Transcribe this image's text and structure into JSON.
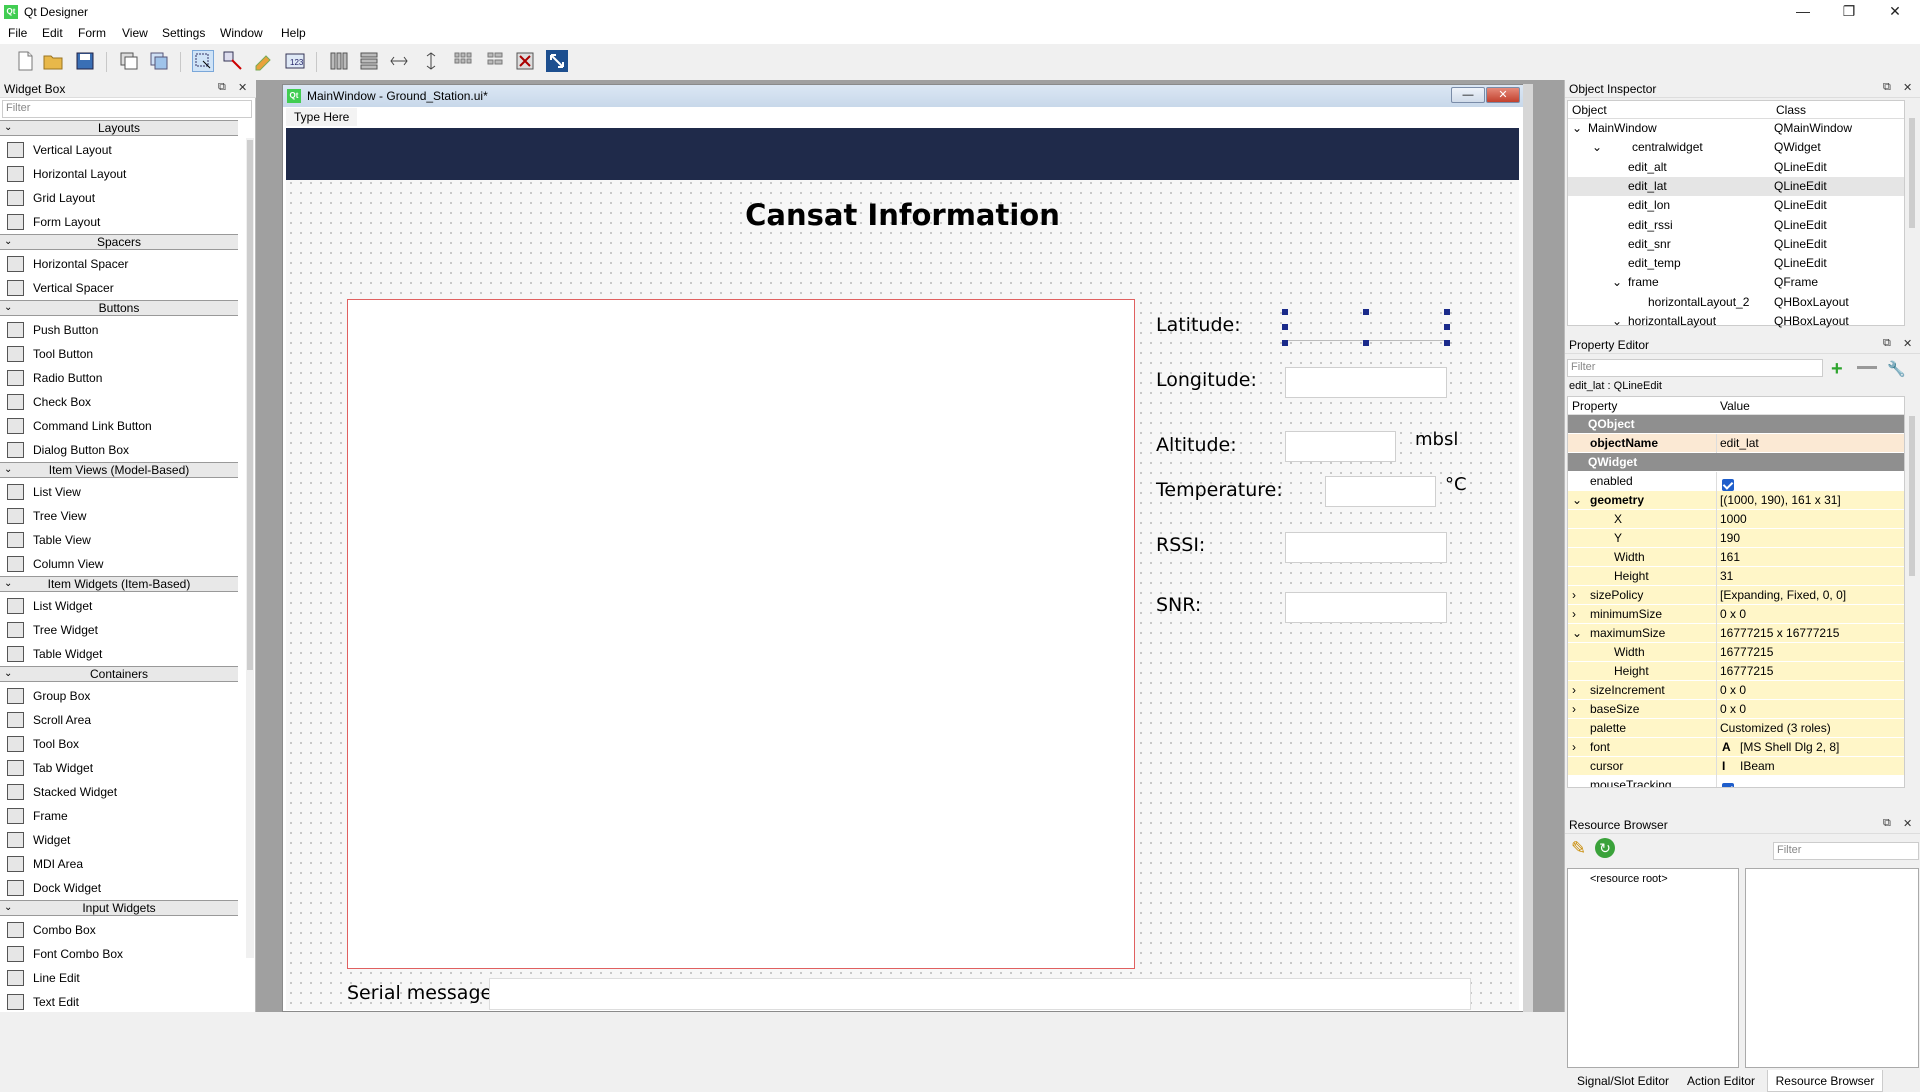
{
  "app": {
    "title": "Qt Designer",
    "logo": "Qt"
  },
  "window_buttons": {
    "minimize": "—",
    "maximize": "❐",
    "close": "✕"
  },
  "menu": [
    "File",
    "Edit",
    "Form",
    "View",
    "Settings",
    "Window",
    "Help"
  ],
  "widget_box": {
    "title": "Widget Box",
    "filter_placeholder": "Filter",
    "categories": [
      {
        "name": "Layouts",
        "items": [
          "Vertical Layout",
          "Horizontal Layout",
          "Grid Layout",
          "Form Layout"
        ]
      },
      {
        "name": "Spacers",
        "items": [
          "Horizontal Spacer",
          "Vertical Spacer"
        ]
      },
      {
        "name": "Buttons",
        "items": [
          "Push Button",
          "Tool Button",
          "Radio Button",
          "Check Box",
          "Command Link Button",
          "Dialog Button Box"
        ]
      },
      {
        "name": "Item Views (Model-Based)",
        "items": [
          "List View",
          "Tree View",
          "Table View",
          "Column View"
        ]
      },
      {
        "name": "Item Widgets (Item-Based)",
        "items": [
          "List Widget",
          "Tree Widget",
          "Table Widget"
        ]
      },
      {
        "name": "Containers",
        "items": [
          "Group Box",
          "Scroll Area",
          "Tool Box",
          "Tab Widget",
          "Stacked Widget",
          "Frame",
          "Widget",
          "MDI Area",
          "Dock Widget"
        ]
      },
      {
        "name": "Input Widgets",
        "items": [
          "Combo Box",
          "Font Combo Box",
          "Line Edit",
          "Text Edit"
        ]
      }
    ]
  },
  "form": {
    "window_title": "MainWindow - Ground_Station.ui*",
    "menu_placeholder": "Type Here",
    "heading": "Cansat Information",
    "fields": {
      "latitude": "Latitude:",
      "longitude": "Longitude:",
      "altitude": "Altitude:",
      "altitude_unit": "mbsl",
      "temperature": "Temperature:",
      "temperature_unit": "°C",
      "rssi": "RSSI:",
      "snr": "SNR:"
    },
    "serial_label": "Serial message:",
    "navbar_color": "#1f2a4a"
  },
  "object_inspector": {
    "title": "Object Inspector",
    "columns": [
      "Object",
      "Class"
    ],
    "rows": [
      {
        "object": "MainWindow",
        "class": "QMainWindow",
        "indent": 0,
        "expand": "⌄"
      },
      {
        "object": "centralwidget",
        "class": "QWidget",
        "indent": 1,
        "expand": "⌄"
      },
      {
        "object": "edit_alt",
        "class": "QLineEdit",
        "indent": 2,
        "expand": ""
      },
      {
        "object": "edit_lat",
        "class": "QLineEdit",
        "indent": 2,
        "expand": "",
        "selected": true
      },
      {
        "object": "edit_lon",
        "class": "QLineEdit",
        "indent": 2,
        "expand": ""
      },
      {
        "object": "edit_rssi",
        "class": "QLineEdit",
        "indent": 2,
        "expand": ""
      },
      {
        "object": "edit_snr",
        "class": "QLineEdit",
        "indent": 2,
        "expand": ""
      },
      {
        "object": "edit_temp",
        "class": "QLineEdit",
        "indent": 2,
        "expand": ""
      },
      {
        "object": "frame",
        "class": "QFrame",
        "indent": 2,
        "expand": "⌄"
      },
      {
        "object": "horizontalLayout_2",
        "class": "QHBoxLayout",
        "indent": 3,
        "expand": ""
      },
      {
        "object": "horizontalLayout",
        "class": "QHBoxLayout",
        "indent": 2,
        "expand": "⌄"
      }
    ]
  },
  "property_editor": {
    "title": "Property Editor",
    "filter_placeholder": "Filter",
    "context": "edit_lat : QLineEdit",
    "columns": [
      "Property",
      "Value"
    ],
    "rows": [
      {
        "name": "QObject",
        "value": "",
        "type": "group"
      },
      {
        "name": "objectName",
        "value": "edit_lat",
        "type": "beige",
        "bold": true
      },
      {
        "name": "QWidget",
        "value": "",
        "type": "group"
      },
      {
        "name": "enabled",
        "value": "",
        "type": "plain",
        "check": true
      },
      {
        "name": "geometry",
        "value": "[(1000, 190), 161 x 31]",
        "type": "yel",
        "bold": true,
        "expand": "⌄"
      },
      {
        "name": "X",
        "value": "1000",
        "type": "yel",
        "sub": true
      },
      {
        "name": "Y",
        "value": "190",
        "type": "yel",
        "sub": true
      },
      {
        "name": "Width",
        "value": "161",
        "type": "yel",
        "sub": true
      },
      {
        "name": "Height",
        "value": "31",
        "type": "yel",
        "sub": true
      },
      {
        "name": "sizePolicy",
        "value": "[Expanding, Fixed, 0, 0]",
        "type": "yel",
        "expand": "›"
      },
      {
        "name": "minimumSize",
        "value": "0 x 0",
        "type": "yel",
        "expand": "›"
      },
      {
        "name": "maximumSize",
        "value": "16777215 x 16777215",
        "type": "yel",
        "expand": "⌄"
      },
      {
        "name": "Width",
        "value": "16777215",
        "type": "yel",
        "sub": true
      },
      {
        "name": "Height",
        "value": "16777215",
        "type": "yel",
        "sub": true
      },
      {
        "name": "sizeIncrement",
        "value": "0 x 0",
        "type": "yel",
        "expand": "›"
      },
      {
        "name": "baseSize",
        "value": "0 x 0",
        "type": "yel",
        "expand": "›"
      },
      {
        "name": "palette",
        "value": "Customized (3 roles)",
        "type": "yel"
      },
      {
        "name": "font",
        "value": "[MS Shell Dlg 2, 8]",
        "type": "yel",
        "expand": "›",
        "prefix": "A"
      },
      {
        "name": "cursor",
        "value": "IBeam",
        "type": "yel",
        "prefix": "I"
      },
      {
        "name": "mouseTracking",
        "value": "",
        "type": "plain",
        "check": true
      }
    ]
  },
  "resource_browser": {
    "title": "Resource Browser",
    "filter_placeholder": "Filter",
    "root": "<resource root>"
  },
  "bottom_tabs": [
    "Signal/Slot Editor",
    "Action Editor",
    "Resource Browser"
  ]
}
